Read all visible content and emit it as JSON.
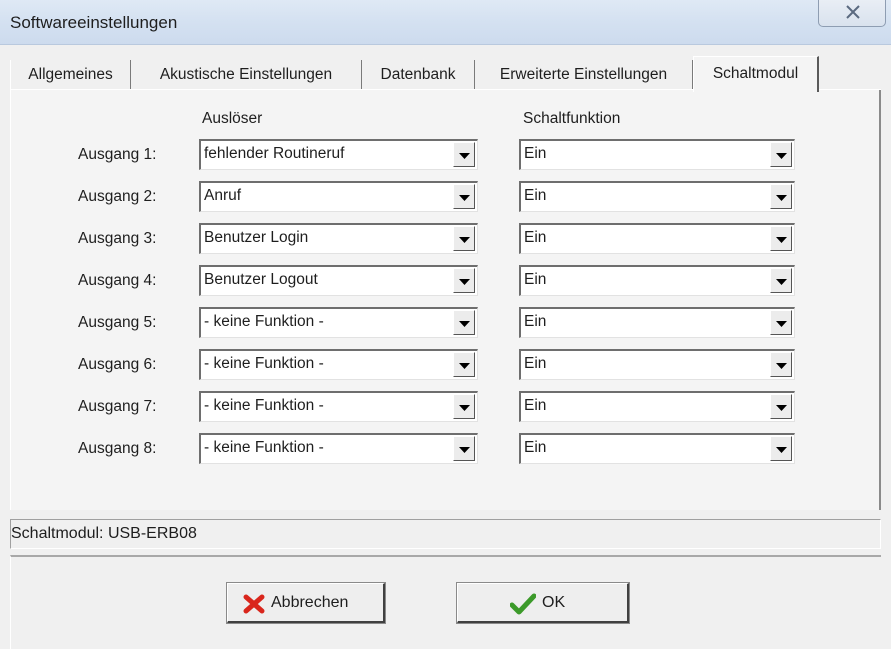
{
  "window": {
    "title": "Softwareeinstellungen"
  },
  "tabs": [
    {
      "label": "Allgemeines"
    },
    {
      "label": "Akustische Einstellungen"
    },
    {
      "label": "Datenbank"
    },
    {
      "label": "Erweiterte Einstellungen"
    },
    {
      "label": "Schaltmodul",
      "active": true
    }
  ],
  "headers": {
    "trigger": "Auslöser",
    "function": "Schaltfunktion"
  },
  "outputs": [
    {
      "label": "Ausgang 1:",
      "trigger": "fehlender Routineruf",
      "function": "Ein"
    },
    {
      "label": "Ausgang 2:",
      "trigger": "Anruf",
      "function": "Ein"
    },
    {
      "label": "Ausgang 3:",
      "trigger": "Benutzer Login",
      "function": "Ein"
    },
    {
      "label": "Ausgang 4:",
      "trigger": "Benutzer Logout",
      "function": "Ein"
    },
    {
      "label": "Ausgang 5:",
      "trigger": "- keine Funktion -",
      "function": "Ein"
    },
    {
      "label": "Ausgang 6:",
      "trigger": "- keine Funktion -",
      "function": "Ein"
    },
    {
      "label": "Ausgang 7:",
      "trigger": "- keine Funktion -",
      "function": "Ein"
    },
    {
      "label": "Ausgang 8:",
      "trigger": "- keine Funktion -",
      "function": "Ein"
    }
  ],
  "status": {
    "text": "Schaltmodul: USB-ERB08"
  },
  "buttons": {
    "cancel": {
      "label": "Abbrechen",
      "icon": "red-x-icon"
    },
    "ok": {
      "label": "OK",
      "icon": "green-checkmark-icon"
    }
  },
  "colors": {
    "cancel_icon": "#d9261c",
    "ok_icon": "#3c9a2a",
    "titlebar": "#d4e1f1"
  }
}
